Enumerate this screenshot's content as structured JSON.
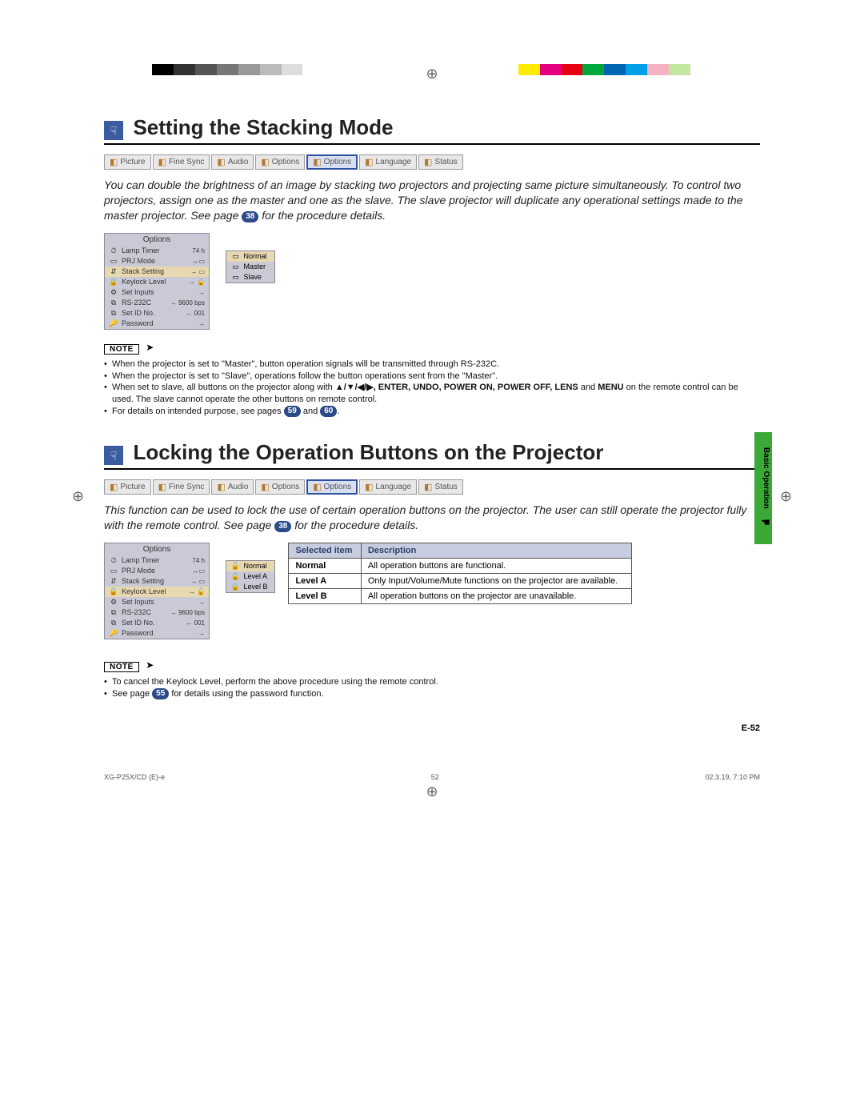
{
  "colorBar": [
    "#000",
    "#333",
    "#555",
    "#777",
    "#999",
    "#bbb",
    "#ddd",
    "#fff",
    "#fff",
    "#fff",
    "#fff",
    "#fff",
    "#fff",
    "#fff",
    "#fff",
    "#fff",
    "#fff",
    "#ffeb00",
    "#e4007f",
    "#e50012",
    "#00a73c",
    "#0066b3",
    "#00a0e9",
    "#f5b2c1",
    "#c3e6a1",
    "#fff"
  ],
  "tabs": [
    {
      "label": "Picture"
    },
    {
      "label": "Fine Sync"
    },
    {
      "label": "Audio"
    },
    {
      "label": "Options"
    },
    {
      "label": "Options",
      "selected": true
    },
    {
      "label": "Language"
    },
    {
      "label": "Status"
    }
  ],
  "section1": {
    "title": "Setting the Stacking Mode",
    "body_a": "You can double the brightness of an image by stacking two projectors and projecting same picture simultaneously. To control two projectors, assign one as the master and one as the slave. The slave projector will duplicate any operational settings made to the master projector. See page ",
    "body_ref": "38",
    "body_b": " for the procedure details.",
    "osd_title": "Options",
    "osd_rows": [
      {
        "icon": "⏱",
        "label": "Lamp Timer",
        "val": "74 h"
      },
      {
        "icon": "▭",
        "label": "PRJ Mode",
        "val": "↔▭"
      },
      {
        "icon": "⇵",
        "label": "Stack Setting",
        "val": "→ ▭",
        "sel": true
      },
      {
        "icon": "🔒",
        "label": "Keylock Level",
        "val": "→ 🔓"
      },
      {
        "icon": "⚙",
        "label": "Set Inputs",
        "val": "→"
      },
      {
        "icon": "⧉",
        "label": "RS-232C",
        "val": "→ 9600 bps"
      },
      {
        "icon": "⧉",
        "label": "Set ID No.",
        "val": "← 001"
      },
      {
        "icon": "🔑",
        "label": "Password",
        "val": "→"
      }
    ],
    "osd_sub": [
      {
        "icon": "▭",
        "label": "Normal",
        "sel": true
      },
      {
        "icon": "▭",
        "label": "Master"
      },
      {
        "icon": "▭",
        "label": "Slave"
      }
    ],
    "note_label": "NOTE",
    "notes": [
      {
        "t": "When the projector is set to \"Master\", button operation signals will be transmitted through RS-232C."
      },
      {
        "t": "When the projector is set to \"Slave\", operations follow the button operations sent from the \"Master\"."
      },
      {
        "pre": "When set to slave, all buttons on the projector along with ",
        "bold": "▲/▼/◀/▶, ENTER, UNDO, POWER ON, POWER OFF, LENS",
        "mid": " and ",
        "bold2": "MENU",
        "post": " on the remote control can be used. The slave cannot operate the other buttons on remote control."
      },
      {
        "t_pre": "For details on intended purpose, see pages ",
        "ref1": "59",
        "t_mid": " and ",
        "ref2": "60",
        "t_post": "."
      }
    ]
  },
  "section2": {
    "title": "Locking the Operation Buttons on the Projector",
    "body_a": "This function can be used to lock the use of certain operation buttons on the projector. The user can still operate the projector fully with the remote control. See page ",
    "body_ref": "38",
    "body_b": " for the procedure details.",
    "osd_title": "Options",
    "osd_rows": [
      {
        "icon": "⏱",
        "label": "Lamp Timer",
        "val": "74 h"
      },
      {
        "icon": "▭",
        "label": "PRJ Mode",
        "val": "↔▭"
      },
      {
        "icon": "⇵",
        "label": "Stack Setting",
        "val": "→ ▭"
      },
      {
        "icon": "🔒",
        "label": "Keylock Level",
        "val": "→ 🔓",
        "sel": true
      },
      {
        "icon": "⚙",
        "label": "Set Inputs",
        "val": "→"
      },
      {
        "icon": "⧉",
        "label": "RS-232C",
        "val": "→ 9600 bps"
      },
      {
        "icon": "⧉",
        "label": "Set ID No.",
        "val": "← 001"
      },
      {
        "icon": "🔑",
        "label": "Password",
        "val": "→"
      }
    ],
    "osd_sub": [
      {
        "icon": "🔓",
        "label": "Normal",
        "sel": true
      },
      {
        "icon": "🔒",
        "label": "Level A"
      },
      {
        "icon": "🔒",
        "label": "Level B"
      }
    ],
    "table": {
      "head": [
        "Selected item",
        "Description"
      ],
      "rows": [
        [
          "Normal",
          "All operation buttons are functional."
        ],
        [
          "Level A",
          "Only Input/Volume/Mute functions on the projector are available."
        ],
        [
          "Level B",
          "All operation buttons on the projector are unavailable."
        ]
      ]
    },
    "note_label": "NOTE",
    "notes": [
      {
        "t": "To cancel the Keylock Level, perform the above procedure using the remote control."
      },
      {
        "t_pre": "See page ",
        "ref1": "55",
        "t_post": " for details using the password function."
      }
    ]
  },
  "side_tab": "Basic Operation",
  "page_num": "E-52",
  "footer": {
    "left": "XG-P25X/CD (E)-e",
    "center": "52",
    "right": "02.3.19, 7:10 PM"
  }
}
